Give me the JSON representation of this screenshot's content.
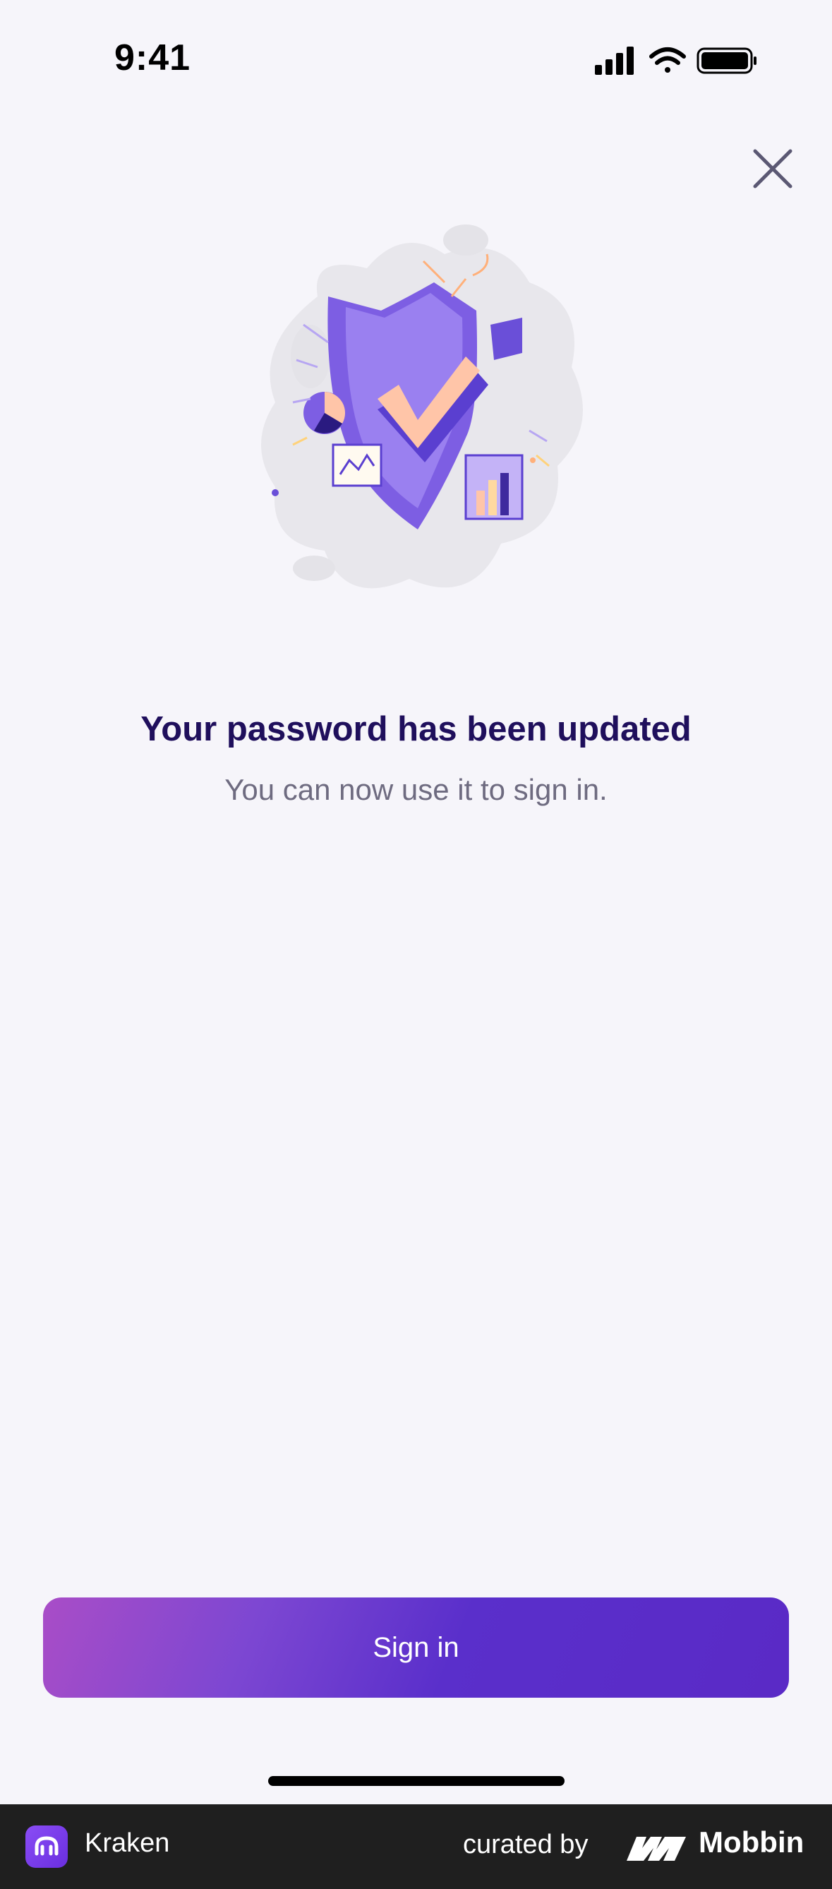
{
  "status_bar": {
    "time": "9:41"
  },
  "main": {
    "title": "Your password has been updated",
    "subtitle": "You can now use it to sign in.",
    "sign_in_label": "Sign in"
  },
  "icons": [
    "close-icon",
    "security-shield-illustration",
    "signal-icon",
    "wifi-icon",
    "battery-icon",
    "kraken-logo",
    "mobbin-logo"
  ],
  "colors": {
    "title": "#1f0f5c",
    "subtitle": "#6e6b80",
    "button_start": "#a94dc7",
    "button_end": "#5a2ac6",
    "background": "#f6f5fa"
  },
  "footer": {
    "app_name": "Kraken",
    "curated_by": "curated by",
    "brand": "Mobbin"
  }
}
